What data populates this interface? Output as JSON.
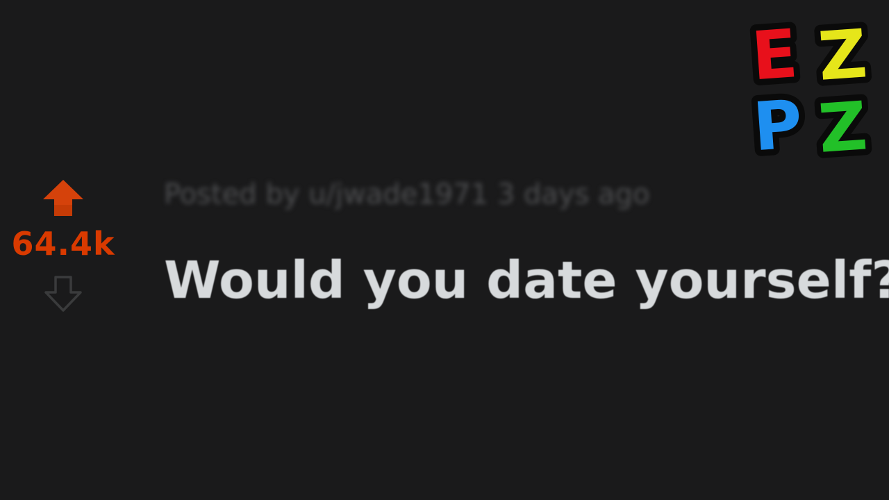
{
  "post": {
    "score": "64.4k",
    "meta_text": "Posted by u/jwade1971 3 days ago",
    "title": "Would you date yourself?"
  },
  "logo": {
    "letters": [
      "E",
      "Z",
      "P",
      "Z"
    ],
    "colors": [
      "#e8101b",
      "#e6e61a",
      "#1e8ff0",
      "#22c028"
    ]
  },
  "colors": {
    "background": "#1a1a1b",
    "upvote_active": "#d93a00",
    "downvote_inactive": "#3a3b3c",
    "title_text": "#d7dadc",
    "meta_text": "#4e4f51"
  },
  "icons": {
    "upvote": "upvote-arrow-icon",
    "downvote": "downvote-arrow-icon"
  }
}
